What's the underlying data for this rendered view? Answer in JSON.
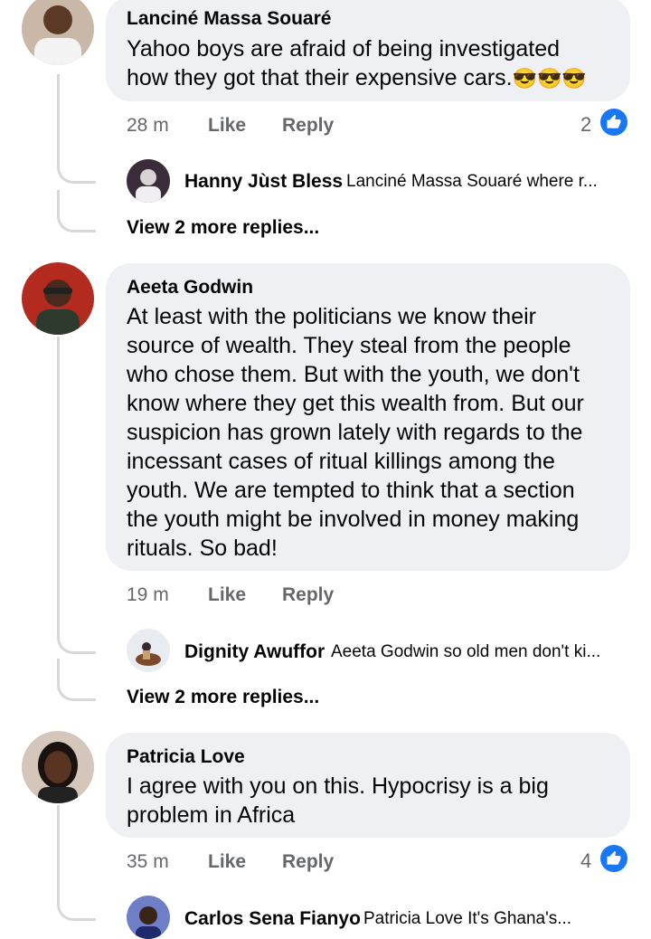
{
  "colors": {
    "bubble": "#eff0f3",
    "meta": "#65676b",
    "like_blue": "#1877f2",
    "thread_line": "#d6d8dc"
  },
  "comments": [
    {
      "author": "Lanciné Massa Souaré",
      "text_lines": [
        "Yahoo boys are afraid of being investigated",
        "how they got that their expensive cars."
      ],
      "emoji": "😎😎😎",
      "time": "28 m",
      "like_label": "Like",
      "reply_label": "Reply",
      "reaction_count": "2",
      "reply_preview": {
        "author": "Hanny Jùst Bless",
        "snippet": "Lanciné Massa Souaré where r..."
      },
      "more_replies": "View 2 more replies..."
    },
    {
      "author": "Aeeta Godwin",
      "text_lines": [
        "At least with the politicians we know their",
        "source of wealth. They steal from the people",
        "who chose them. But with the youth, we don't",
        "know where they get this wealth from. But our",
        "suspicion has grown lately with regards to the",
        "incessant cases of ritual killings among the",
        "youth. We are tempted to think that a section",
        "the youth might be involved in money making",
        "rituals. So bad!"
      ],
      "time": "19 m",
      "like_label": "Like",
      "reply_label": "Reply",
      "reply_preview": {
        "author": "Dignity Awuffor",
        "snippet": "Aeeta Godwin so old men don't ki..."
      },
      "more_replies": "View 2 more replies..."
    },
    {
      "author": "Patricia Love",
      "text_lines": [
        "I agree with you on this. Hypocrisy is a big",
        "problem in Africa"
      ],
      "time": "35 m",
      "like_label": "Like",
      "reply_label": "Reply",
      "reaction_count": "4",
      "reply_preview": {
        "author": "Carlos Sena Fianyo",
        "snippet": "Patricia Love It's Ghana's..."
      }
    }
  ]
}
